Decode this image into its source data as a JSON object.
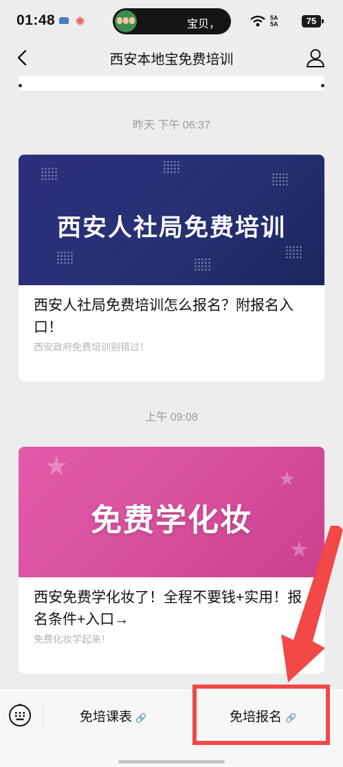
{
  "status": {
    "time": "01:48",
    "notification": "宝贝，",
    "signal": "5A\n5A",
    "battery": "75"
  },
  "nav": {
    "title": "西安本地宝免费培训"
  },
  "messages": [
    {
      "timestamp": "昨天 下午 06:37",
      "banner_text": "西安人社局免费培训",
      "title": "西安人社局免费培训怎么报名？附报名入口！",
      "subtitle": "西安政府免费培训别错过！"
    },
    {
      "timestamp": "上午 09:08",
      "banner_text": "免费学化妆",
      "title": "西安免费学化妆了！全程不要钱+实用！报名条件+入口→",
      "subtitle": "免费化妆学起来！"
    }
  ],
  "menu": {
    "item1": "免培课表",
    "item2": "免培报名",
    "link_icon": "🔗"
  },
  "colors": {
    "highlight": "#f24848",
    "banner1": "#2b2e7a",
    "banner2": "#dc56a5"
  }
}
